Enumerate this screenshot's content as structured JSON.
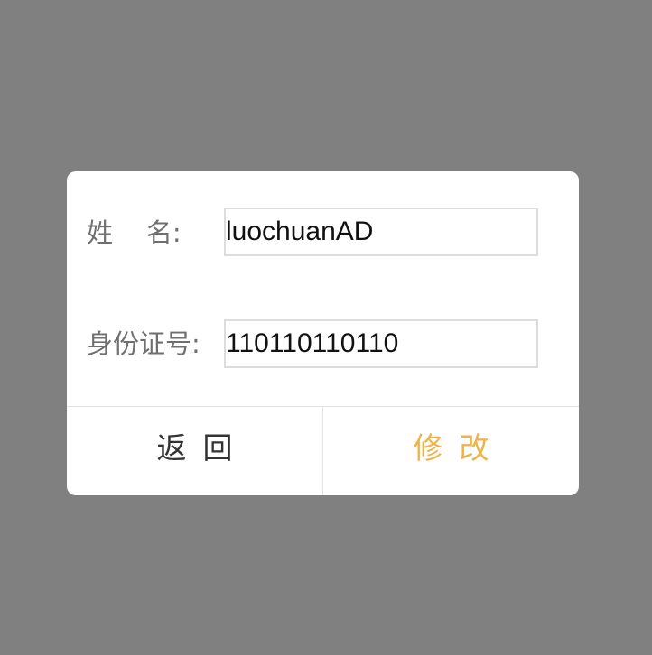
{
  "dialog": {
    "name_label": "姓    名:",
    "name_value": "luochuanAD",
    "id_label": "身份证号:",
    "id_value": "110110110110",
    "back_label": "返回",
    "modify_label": "修改"
  },
  "colors": {
    "overlay": "#808080",
    "accent": "#f0b347",
    "label": "#6f6f6f"
  }
}
